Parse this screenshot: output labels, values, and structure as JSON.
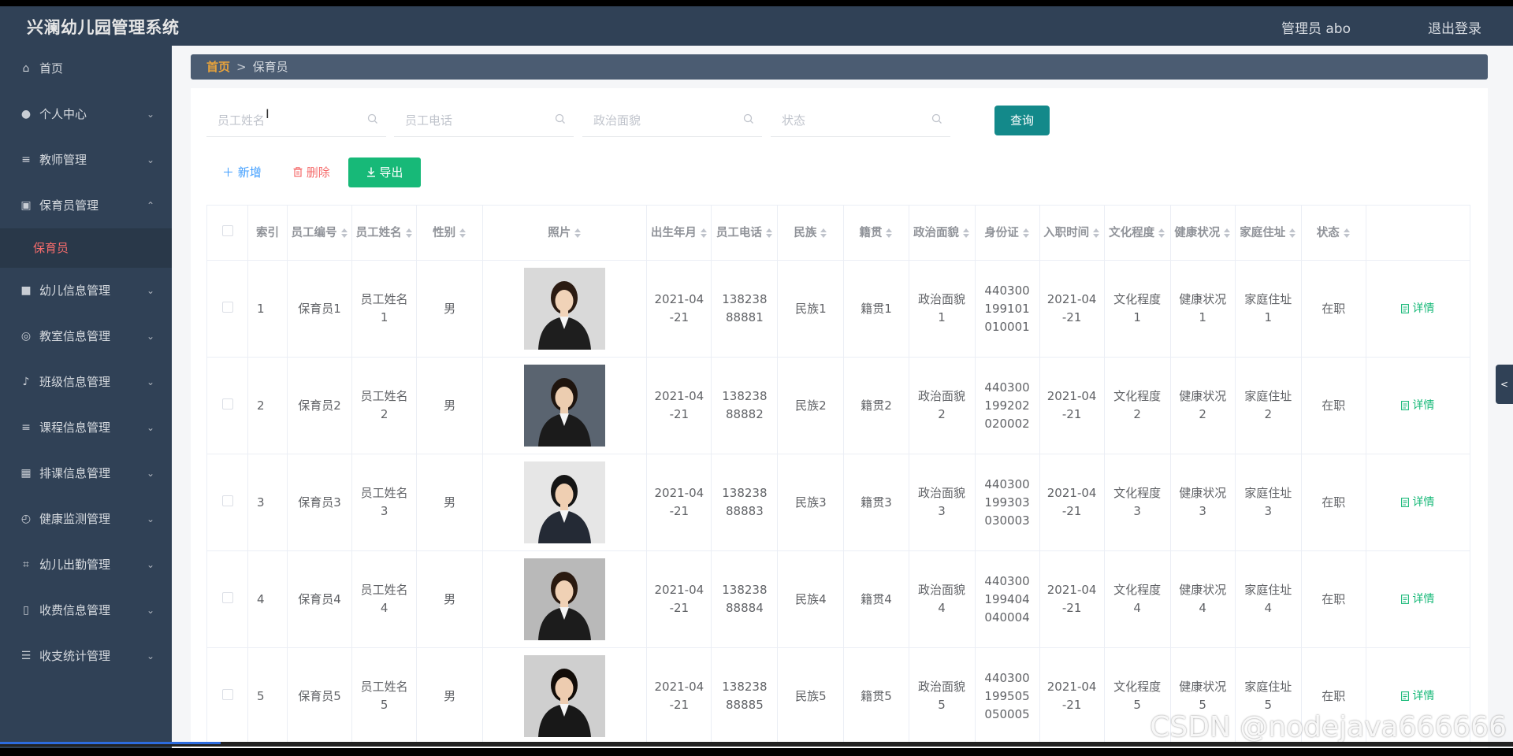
{
  "header": {
    "title": "兴澜幼儿园管理系统",
    "user": "管理员 abo",
    "logout": "退出登录"
  },
  "sidebar": {
    "items": [
      {
        "label": "首页",
        "icon": "home-icon",
        "arrow": ""
      },
      {
        "label": "个人中心",
        "icon": "user-icon",
        "arrow": "chevron-down"
      },
      {
        "label": "教师管理",
        "icon": "list-icon",
        "arrow": "chevron-down"
      },
      {
        "label": "保育员管理",
        "icon": "folder-icon",
        "arrow": "chevron-up"
      },
      {
        "label": "幼儿信息管理",
        "icon": "video-icon",
        "arrow": "chevron-down"
      },
      {
        "label": "教室信息管理",
        "icon": "compass-icon",
        "arrow": "chevron-down"
      },
      {
        "label": "班级信息管理",
        "icon": "bell-icon",
        "arrow": "chevron-down"
      },
      {
        "label": "课程信息管理",
        "icon": "list-icon",
        "arrow": "chevron-down"
      },
      {
        "label": "排课信息管理",
        "icon": "grid-icon",
        "arrow": "chevron-down"
      },
      {
        "label": "健康监测管理",
        "icon": "gauge-icon",
        "arrow": "chevron-down"
      },
      {
        "label": "幼儿出勤管理",
        "icon": "crop-icon",
        "arrow": "chevron-down"
      },
      {
        "label": "收费信息管理",
        "icon": "phone-icon",
        "arrow": "chevron-down"
      },
      {
        "label": "收支统计管理",
        "icon": "sliders-icon",
        "arrow": "chevron-down"
      }
    ],
    "submenu_active": "保育员"
  },
  "breadcrumb": {
    "home": "首页",
    "separator": ">",
    "current": "保育员"
  },
  "search": {
    "name_placeholder": "员工姓名",
    "phone_placeholder": "员工电话",
    "politics_placeholder": "政治面貌",
    "status_placeholder": "状态",
    "query_label": "查询"
  },
  "actions": {
    "add": "新增",
    "delete": "删除",
    "export": "导出"
  },
  "table": {
    "columns": [
      "索引",
      "员工编号",
      "员工姓名",
      "性别",
      "照片",
      "出生年月",
      "员工电话",
      "民族",
      "籍贯",
      "政治面貌",
      "身份证",
      "入职时间",
      "文化程度",
      "健康状况",
      "家庭住址",
      "状态"
    ],
    "detail_label": "详情",
    "rows": [
      {
        "index": "1",
        "code": "保育员1",
        "name": "员工姓名1",
        "gender": "男",
        "birth": "2021-04-21",
        "phone": "13823888881",
        "ethnic": "民族1",
        "origin": "籍贯1",
        "politics": "政治面貌1",
        "id_card": "440300199101010001",
        "join": "2021-04-21",
        "education": "文化程度1",
        "health": "健康状况1",
        "address": "家庭住址1",
        "status": "在职"
      },
      {
        "index": "2",
        "code": "保育员2",
        "name": "员工姓名2",
        "gender": "男",
        "birth": "2021-04-21",
        "phone": "13823888882",
        "ethnic": "民族2",
        "origin": "籍贯2",
        "politics": "政治面貌2",
        "id_card": "440300199202020002",
        "join": "2021-04-21",
        "education": "文化程度2",
        "health": "健康状况2",
        "address": "家庭住址2",
        "status": "在职"
      },
      {
        "index": "3",
        "code": "保育员3",
        "name": "员工姓名3",
        "gender": "男",
        "birth": "2021-04-21",
        "phone": "13823888883",
        "ethnic": "民族3",
        "origin": "籍贯3",
        "politics": "政治面貌3",
        "id_card": "440300199303030003",
        "join": "2021-04-21",
        "education": "文化程度3",
        "health": "健康状况3",
        "address": "家庭住址3",
        "status": "在职"
      },
      {
        "index": "4",
        "code": "保育员4",
        "name": "员工姓名4",
        "gender": "男",
        "birth": "2021-04-21",
        "phone": "13823888884",
        "ethnic": "民族4",
        "origin": "籍贯4",
        "politics": "政治面貌4",
        "id_card": "440300199404040004",
        "join": "2021-04-21",
        "education": "文化程度4",
        "health": "健康状况4",
        "address": "家庭住址4",
        "status": "在职"
      },
      {
        "index": "5",
        "code": "保育员5",
        "name": "员工姓名5",
        "gender": "男",
        "birth": "2021-04-21",
        "phone": "13823888885",
        "ethnic": "民族5",
        "origin": "籍贯5",
        "politics": "政治面貌5",
        "id_card": "440300199505050005",
        "join": "2021-04-21",
        "education": "文化程度5",
        "health": "健康状况5",
        "address": "家庭住址5",
        "status": "在职"
      }
    ]
  },
  "watermark": "CSDN @nodejava666666",
  "colors": {
    "sidebar_bg": "#304156",
    "accent_teal": "#13898a",
    "export_green": "#17b978",
    "danger": "#f56c6c",
    "primary": "#409eff"
  }
}
